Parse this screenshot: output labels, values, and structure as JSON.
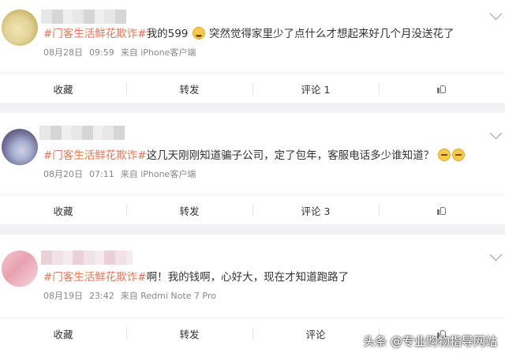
{
  "posts": [
    {
      "topic": "#门客生活鲜花欺诈#",
      "text_a": "我的599",
      "emoji_a": "cry-face-icon",
      "text_b": " 突然觉得家里少了点什么才想起来好几个月没送花了",
      "date": "08月28日",
      "time": "09:59",
      "source": "来自 iPhone客户端",
      "actions": [
        "收藏",
        "转发",
        "评论 1",
        ""
      ]
    },
    {
      "topic": "#门客生活鲜花欺诈#",
      "text_a": "这几天刚刚知道骗子公司，定了包年，客服电话多少谁知道？",
      "date": "08月20日",
      "time": "07:11",
      "source": "来自 iPhone客户端",
      "actions": [
        "收藏",
        "转发",
        "评论 3",
        ""
      ]
    },
    {
      "topic": "#门客生活鲜花欺诈#",
      "text_a": "啊！我的钱啊，心好大，现在才知道跑路了",
      "date": "08月19日",
      "time": "23:42",
      "source": "来自 Redmi Note 7 Pro",
      "actions": [
        "收藏",
        "转发",
        "评论",
        ""
      ]
    }
  ],
  "watermark": "头条 @专业购物指导网站",
  "colors": {
    "topic": "#eb7350",
    "meta": "#888888",
    "background": "#f2f2f5"
  }
}
